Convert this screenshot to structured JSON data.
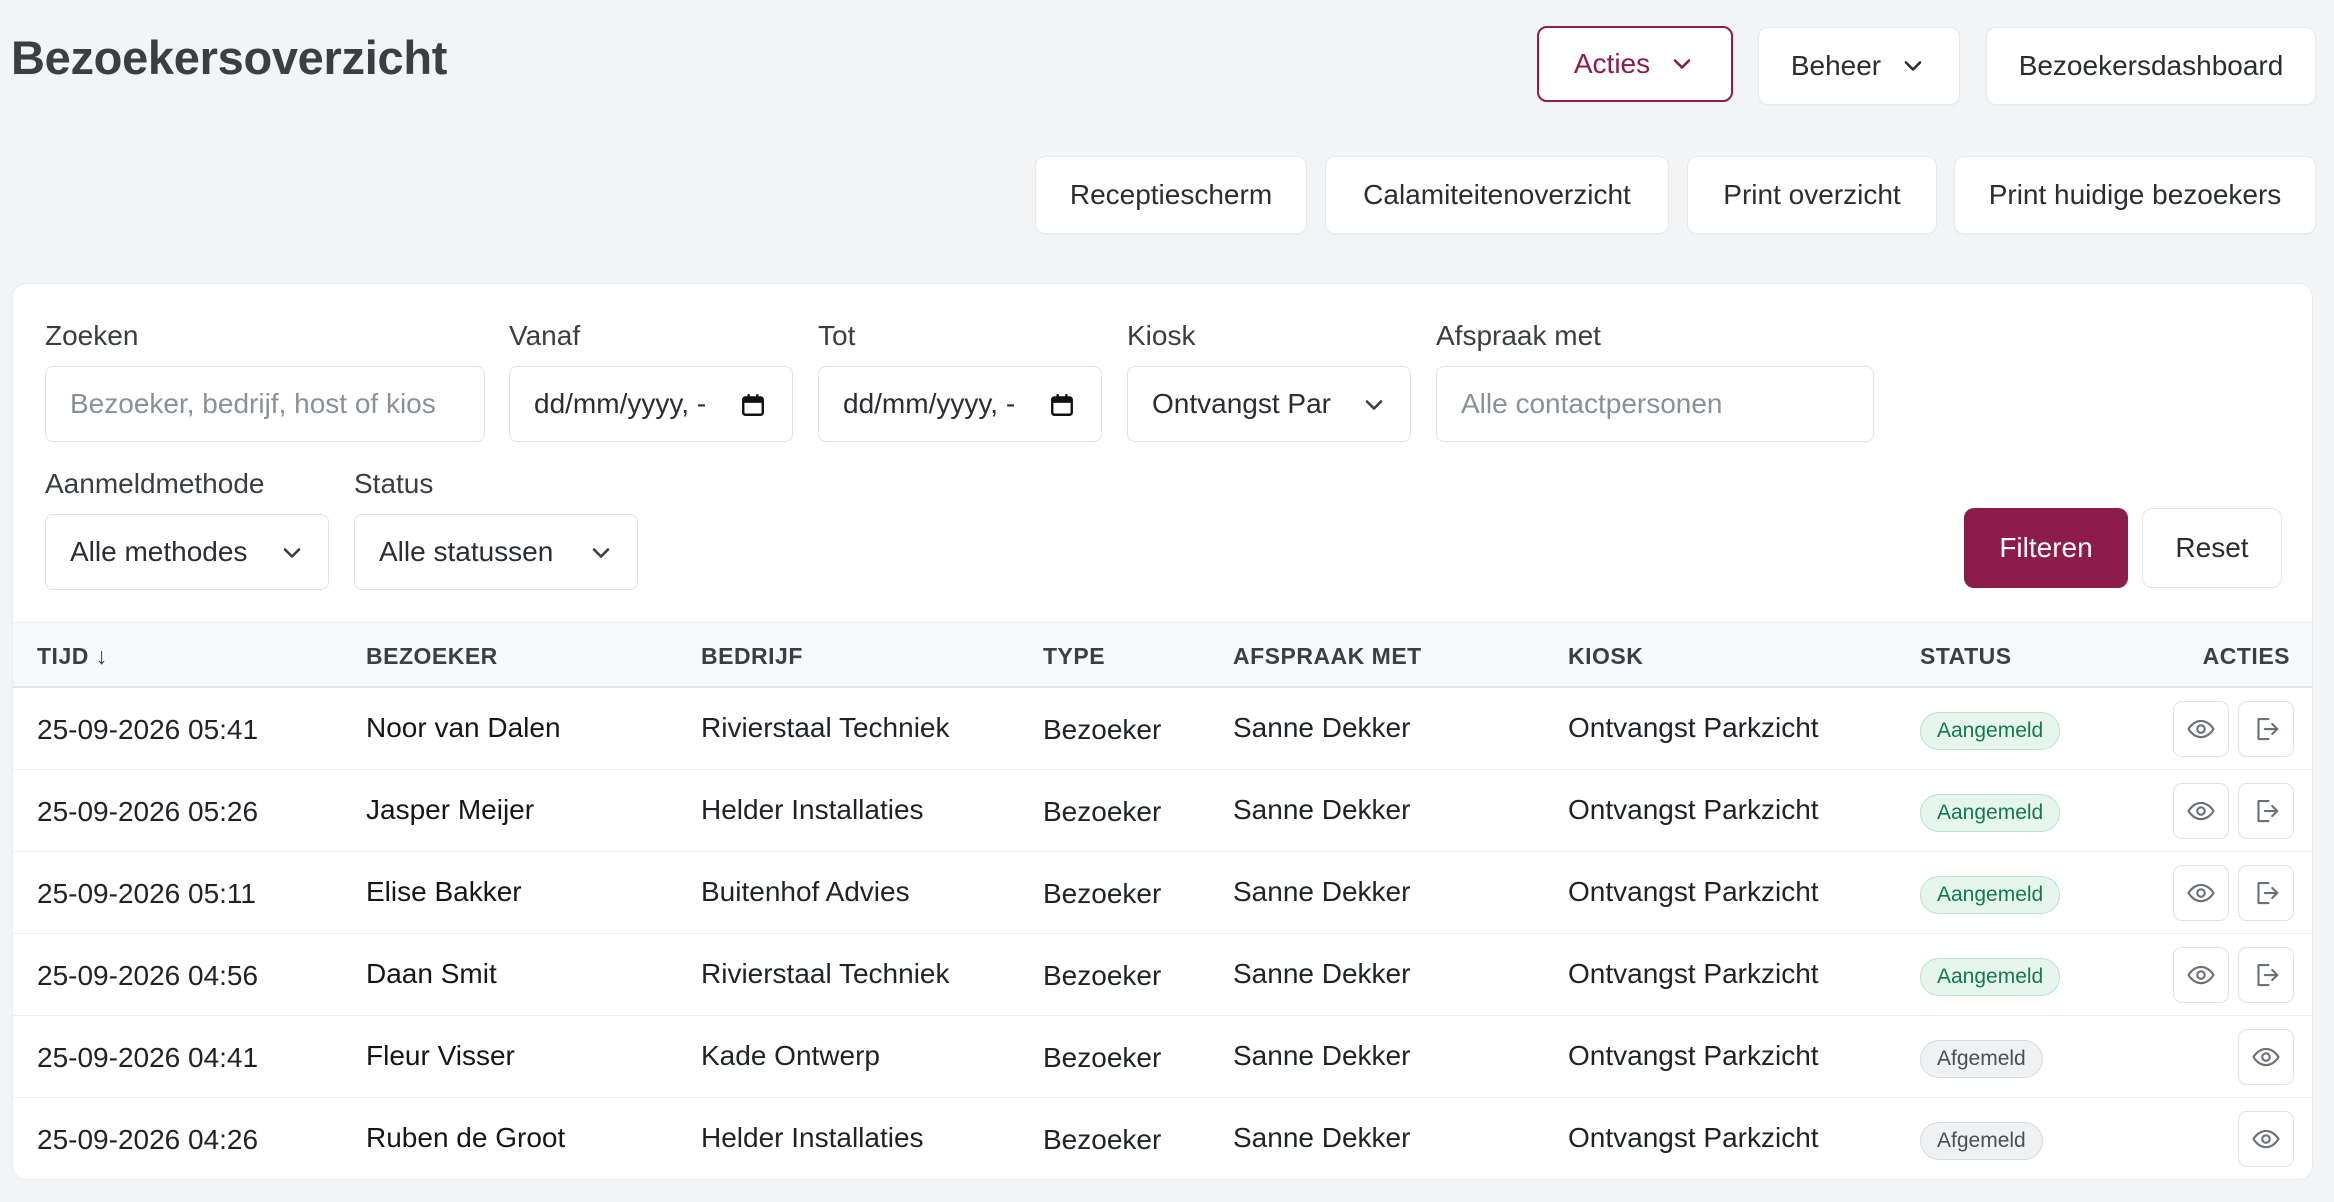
{
  "page": {
    "title": "Bezoekersoverzicht"
  },
  "header": {
    "acties_label": "Acties",
    "beheer_label": "Beheer",
    "dashboard_label": "Bezoekersdashboard",
    "receptiescherm_label": "Receptiescherm",
    "calamiteiten_label": "Calamiteitenoverzicht",
    "print_overzicht_label": "Print overzicht",
    "print_huidige_label": "Print huidige bezoekers"
  },
  "filters": {
    "zoeken_label": "Zoeken",
    "zoeken_placeholder": "Bezoeker, bedrijf, host of kios",
    "vanaf_label": "Vanaf",
    "vanaf_value": "dd/mm/yyyy, -",
    "tot_label": "Tot",
    "tot_value": "dd/mm/yyyy, -",
    "kiosk_label": "Kiosk",
    "kiosk_value": "Ontvangst Par",
    "afspraak_label": "Afspraak met",
    "afspraak_placeholder": "Alle contactpersonen",
    "methode_label": "Aanmeldmethode",
    "methode_value": "Alle methodes",
    "status_label": "Status",
    "status_value": "Alle statussen",
    "filter_button": "Filteren",
    "reset_button": "Reset"
  },
  "table": {
    "columns": [
      "TIJD ↓",
      "BEZOEKER",
      "BEDRIJF",
      "TYPE",
      "AFSPRAAK MET",
      "KIOSK",
      "STATUS",
      "ACTIES"
    ],
    "rows": [
      {
        "tijd": "25-09-2026 05:41",
        "bezoeker": "Noor van Dalen",
        "bedrijf": "Rivierstaal Techniek",
        "type": "Bezoeker",
        "afspraak": "Sanne Dekker",
        "kiosk": "Ontvangst Parkzicht",
        "status": "Aangemeld"
      },
      {
        "tijd": "25-09-2026 05:26",
        "bezoeker": "Jasper Meijer",
        "bedrijf": "Helder Installaties",
        "type": "Bezoeker",
        "afspraak": "Sanne Dekker",
        "kiosk": "Ontvangst Parkzicht",
        "status": "Aangemeld"
      },
      {
        "tijd": "25-09-2026 05:11",
        "bezoeker": "Elise Bakker",
        "bedrijf": "Buitenhof Advies",
        "type": "Bezoeker",
        "afspraak": "Sanne Dekker",
        "kiosk": "Ontvangst Parkzicht",
        "status": "Aangemeld"
      },
      {
        "tijd": "25-09-2026 04:56",
        "bezoeker": "Daan Smit",
        "bedrijf": "Rivierstaal Techniek",
        "type": "Bezoeker",
        "afspraak": "Sanne Dekker",
        "kiosk": "Ontvangst Parkzicht",
        "status": "Aangemeld"
      },
      {
        "tijd": "25-09-2026 04:41",
        "bezoeker": "Fleur Visser",
        "bedrijf": "Kade Ontwerp",
        "type": "Bezoeker",
        "afspraak": "Sanne Dekker",
        "kiosk": "Ontvangst Parkzicht",
        "status": "Afgemeld"
      },
      {
        "tijd": "25-09-2026 04:26",
        "bezoeker": "Ruben de Groot",
        "bedrijf": "Helder Installaties",
        "type": "Bezoeker",
        "afspraak": "Sanne Dekker",
        "kiosk": "Ontvangst Parkzicht",
        "status": "Afgemeld"
      }
    ],
    "row_actions": [
      "view-icon",
      "checkout-icon"
    ]
  },
  "colors": {
    "accent": "#8c1c48",
    "status_on": "#157a4a",
    "status_off": "#4a4f55"
  }
}
